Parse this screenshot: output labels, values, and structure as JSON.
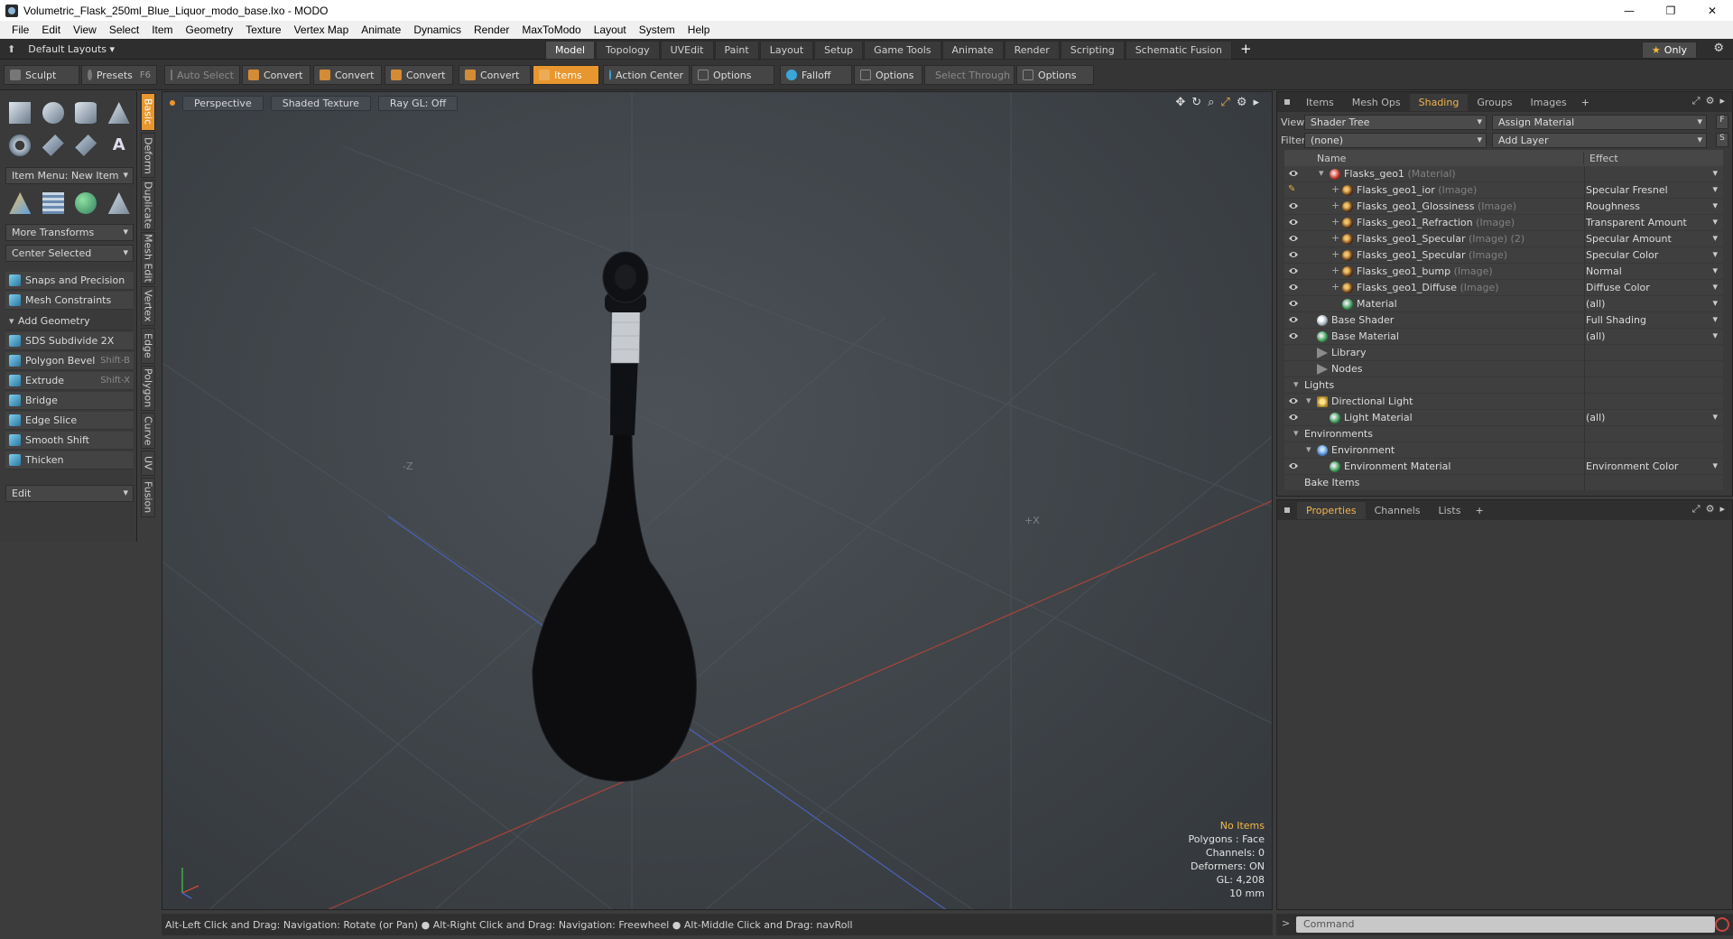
{
  "window": {
    "title": "Volumetric_Flask_250ml_Blue_Liquor_modo_base.lxo - MODO",
    "controls": [
      "—",
      "❐",
      "✕"
    ]
  },
  "menu": [
    "File",
    "Edit",
    "View",
    "Select",
    "Item",
    "Geometry",
    "Texture",
    "Vertex Map",
    "Animate",
    "Dynamics",
    "Render",
    "MaxToModo",
    "Layout",
    "System",
    "Help"
  ],
  "layoutbar": {
    "layout_label": "Default Layouts ▾",
    "tabs": [
      "Model",
      "Topology",
      "UVEdit",
      "Paint",
      "Layout",
      "Setup",
      "Game Tools",
      "Animate",
      "Render",
      "Scripting",
      "Schematic Fusion"
    ],
    "active_tab": "Model",
    "plus": "+",
    "only_label": "Only"
  },
  "toolbar": {
    "sculpt": "Sculpt",
    "presets": "Presets",
    "presets_key": "F6",
    "auto_select": "Auto Select",
    "convert": "Convert",
    "items": "Items",
    "action_center": "Action Center",
    "options": "Options",
    "falloff": "Falloff",
    "select_through": "Select Through"
  },
  "leftpanel": {
    "item_menu": "Item Menu: New Item",
    "more_transforms": "More Transforms",
    "center_selected": "Center Selected",
    "snaps": "Snaps and Precision",
    "mesh_constraints": "Mesh Constraints",
    "add_geometry": "Add Geometry",
    "tools": [
      {
        "label": "SDS Subdivide 2X",
        "key": ""
      },
      {
        "label": "Polygon Bevel",
        "key": "Shift-B"
      },
      {
        "label": "Extrude",
        "key": "Shift-X"
      },
      {
        "label": "Bridge",
        "key": ""
      },
      {
        "label": "Edge Slice",
        "key": ""
      },
      {
        "label": "Smooth Shift",
        "key": ""
      },
      {
        "label": "Thicken",
        "key": ""
      }
    ],
    "edit_dd": "Edit",
    "text_icon": "A"
  },
  "vtabs": [
    "Basic",
    "Deform",
    "Duplicate",
    "Mesh Edit",
    "Vertex",
    "Edge",
    "Polygon",
    "Curve",
    "UV",
    "Fusion"
  ],
  "viewport": {
    "view": "Perspective",
    "shading": "Shaded Texture",
    "raygl": "Ray GL: Off",
    "info": {
      "no_items": "No Items",
      "polygons": "Polygons : Face",
      "channels": "Channels: 0",
      "deformers": "Deformers: ON",
      "gl": "GL: 4,208",
      "scale": "10 mm"
    },
    "axis_labels": {
      "neg_z": "-Z",
      "pos_x": "+X"
    }
  },
  "status": {
    "hint": "Alt-Left Click and Drag: Navigation: Rotate (or Pan) ● Alt-Right Click and Drag: Navigation: Freewheel ● Alt-Middle Click and Drag: navRoll",
    "command_placeholder": "Command"
  },
  "shading_panel": {
    "tabs": [
      "Items",
      "Mesh Ops",
      "Shading",
      "Groups",
      "Images"
    ],
    "active_tab": "Shading",
    "plus": "+",
    "view_label": "View",
    "view_value": "Shader Tree",
    "assign_material": "Assign Material",
    "filter_label": "Filter",
    "filter_value": "(none)",
    "add_layer": "Add Layer",
    "btn_f": "F",
    "btn_s": "S",
    "col_name": "Name",
    "col_effect": "Effect",
    "rows": [
      {
        "name": "Flasks_geo1",
        "type": "(Material)",
        "icon": "matred",
        "indent": 2,
        "expand": "▾",
        "effect": "",
        "eye": true,
        "dd": true
      },
      {
        "name": "Flasks_geo1_ior",
        "type": "(Image)",
        "icon": "img",
        "indent": 3,
        "expand": "+",
        "effect": "Specular Fresnel",
        "eye": false,
        "brush": true,
        "dd": true
      },
      {
        "name": "Flasks_geo1_Glossiness",
        "type": "(Image)",
        "icon": "img",
        "indent": 3,
        "expand": "+",
        "effect": "Roughness",
        "eye": true,
        "dd": true
      },
      {
        "name": "Flasks_geo1_Refraction",
        "type": "(Image)",
        "icon": "img",
        "indent": 3,
        "expand": "+",
        "effect": "Transparent Amount",
        "eye": true,
        "dd": true
      },
      {
        "name": "Flasks_geo1_Specular",
        "type": "(Image) (2)",
        "icon": "img",
        "indent": 3,
        "expand": "+",
        "effect": "Specular Amount",
        "eye": true,
        "dd": true
      },
      {
        "name": "Flasks_geo1_Specular",
        "type": "(Image)",
        "icon": "img",
        "indent": 3,
        "expand": "+",
        "effect": "Specular Color",
        "eye": true,
        "dd": true
      },
      {
        "name": "Flasks_geo1_bump",
        "type": "(Image)",
        "icon": "img",
        "indent": 3,
        "expand": "+",
        "effect": "Normal",
        "eye": true,
        "dd": true
      },
      {
        "name": "Flasks_geo1_Diffuse",
        "type": "(Image)",
        "icon": "img",
        "indent": 3,
        "expand": "+",
        "effect": "Diffuse Color",
        "eye": true,
        "dd": true
      },
      {
        "name": "Material",
        "type": "",
        "icon": "mat",
        "indent": 3,
        "expand": "",
        "effect": "(all)",
        "eye": true,
        "dd": true
      },
      {
        "name": "Base Shader",
        "type": "",
        "icon": "shader",
        "indent": 1,
        "expand": "",
        "effect": "Full Shading",
        "eye": true,
        "dd": true
      },
      {
        "name": "Base Material",
        "type": "",
        "icon": "mat",
        "indent": 1,
        "expand": "",
        "effect": "(all)",
        "eye": true,
        "dd": true
      },
      {
        "name": "Library",
        "type": "",
        "icon": "folder",
        "indent": 1,
        "expand": "",
        "effect": "",
        "eye": false,
        "dd": false
      },
      {
        "name": "Nodes",
        "type": "",
        "icon": "folder",
        "indent": 1,
        "expand": "",
        "effect": "",
        "eye": false,
        "dd": false
      },
      {
        "name": "Lights",
        "type": "",
        "icon": "",
        "indent": 0,
        "expand": "▾",
        "effect": "",
        "eye": false,
        "dd": false
      },
      {
        "name": "Directional Light",
        "type": "",
        "icon": "light",
        "indent": 1,
        "expand": "▾",
        "effect": "",
        "eye": true,
        "dd": false
      },
      {
        "name": "Light Material",
        "type": "",
        "icon": "mat",
        "indent": 2,
        "expand": "",
        "effect": "(all)",
        "eye": true,
        "dd": true
      },
      {
        "name": "Environments",
        "type": "",
        "icon": "",
        "indent": 0,
        "expand": "▾",
        "effect": "",
        "eye": false,
        "dd": false
      },
      {
        "name": "Environment",
        "type": "",
        "icon": "env",
        "indent": 1,
        "expand": "▾",
        "effect": "",
        "eye": false,
        "dd": false
      },
      {
        "name": "Environment Material",
        "type": "",
        "icon": "mat",
        "indent": 2,
        "expand": "",
        "effect": "Environment Color",
        "eye": true,
        "dd": true
      },
      {
        "name": "Bake Items",
        "type": "",
        "icon": "",
        "indent": 0,
        "expand": "",
        "effect": "",
        "eye": false,
        "dd": false
      }
    ]
  },
  "properties_panel": {
    "tabs": [
      "Properties",
      "Channels",
      "Lists"
    ],
    "active_tab": "Properties",
    "plus": "+"
  },
  "colors": {
    "accent": "#e8962e",
    "panel": "#3a3a3a",
    "viewport": "#42474c"
  }
}
